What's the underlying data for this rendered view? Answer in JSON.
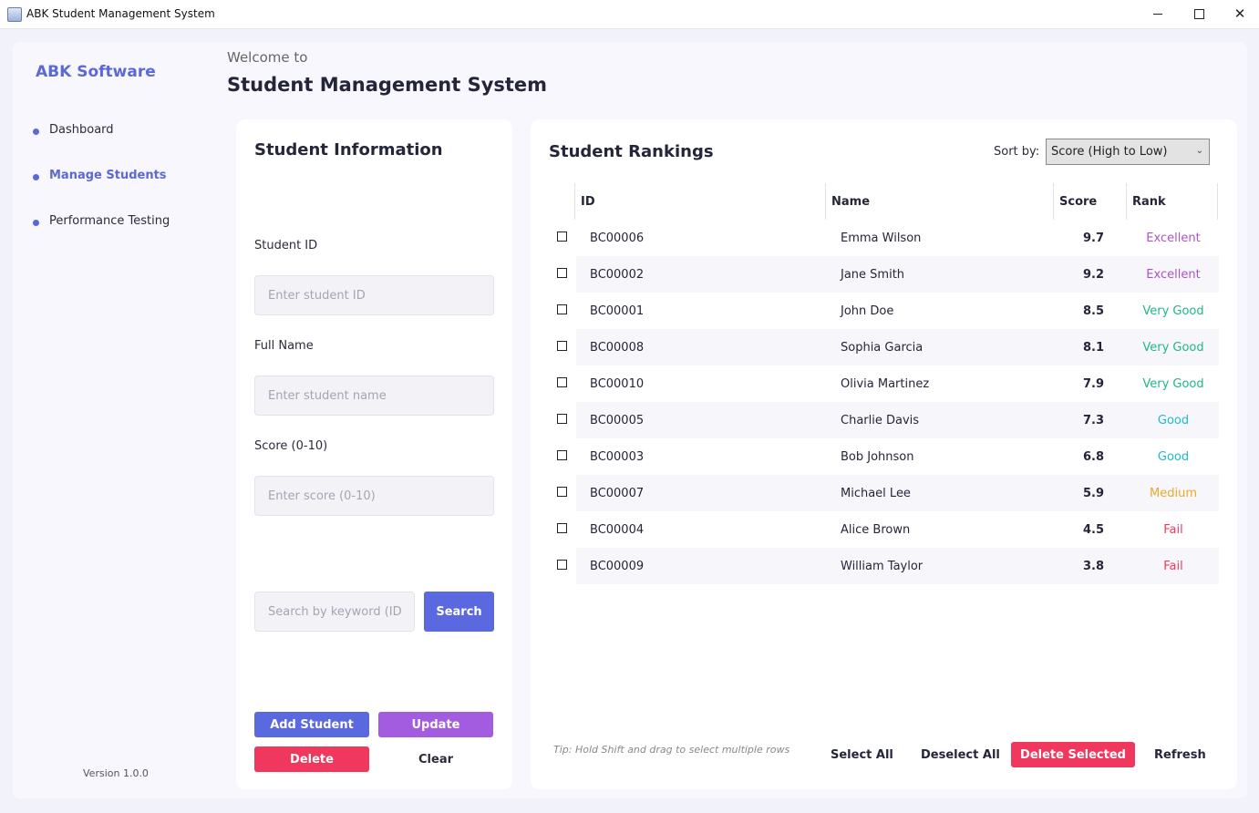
{
  "window": {
    "title": "ABK Student Management System"
  },
  "sidebar": {
    "brand": "ABK Software",
    "items": [
      {
        "label": "Dashboard",
        "active": false
      },
      {
        "label": "Manage Students",
        "active": true
      },
      {
        "label": "Performance Testing",
        "active": false
      }
    ],
    "version": "Version 1.0.0"
  },
  "header": {
    "welcome": "Welcome to",
    "title": "Student Management System"
  },
  "form": {
    "title": "Student Information",
    "student_id_label": "Student ID",
    "student_id_placeholder": "Enter student ID",
    "full_name_label": "Full Name",
    "full_name_placeholder": "Enter student name",
    "score_label": "Score (0-10)",
    "score_placeholder": "Enter score (0-10)",
    "search_placeholder": "Search by keyword (ID, name)",
    "search_button": "Search",
    "add_button": "Add Student",
    "update_button": "Update",
    "delete_button": "Delete",
    "clear_button": "Clear"
  },
  "rankings": {
    "title": "Student Rankings",
    "sort_label": "Sort by:",
    "sort_value": "Score (High to Low)",
    "columns": [
      "ID",
      "Name",
      "Score",
      "Rank"
    ],
    "rows": [
      {
        "id": "BC00006",
        "name": "Emma Wilson",
        "score": "9.7",
        "rank": "Excellent"
      },
      {
        "id": "BC00002",
        "name": "Jane Smith",
        "score": "9.2",
        "rank": "Excellent"
      },
      {
        "id": "BC00001",
        "name": "John Doe",
        "score": "8.5",
        "rank": "Very Good"
      },
      {
        "id": "BC00008",
        "name": "Sophia Garcia",
        "score": "8.1",
        "rank": "Very Good"
      },
      {
        "id": "BC00010",
        "name": "Olivia Martinez",
        "score": "7.9",
        "rank": "Very Good"
      },
      {
        "id": "BC00005",
        "name": "Charlie Davis",
        "score": "7.3",
        "rank": "Good"
      },
      {
        "id": "BC00003",
        "name": "Bob Johnson",
        "score": "6.8",
        "rank": "Good"
      },
      {
        "id": "BC00007",
        "name": "Michael Lee",
        "score": "5.9",
        "rank": "Medium"
      },
      {
        "id": "BC00004",
        "name": "Alice Brown",
        "score": "4.5",
        "rank": "Fail"
      },
      {
        "id": "BC00009",
        "name": "William Taylor",
        "score": "3.8",
        "rank": "Fail"
      }
    ],
    "rank_colors": {
      "Excellent": "#a855c7",
      "Very Good": "#22b58a",
      "Good": "#1fb9d0",
      "Medium": "#e9a82a",
      "Fail": "#ee3a5e"
    },
    "tip": "Tip: Hold Shift and drag to select multiple rows",
    "select_all": "Select All",
    "deselect_all": "Deselect All",
    "delete_selected": "Delete Selected",
    "refresh": "Refresh"
  },
  "colors": {
    "accent": "#5b69e0",
    "purple": "#a35ce0",
    "danger": "#f0385e"
  }
}
